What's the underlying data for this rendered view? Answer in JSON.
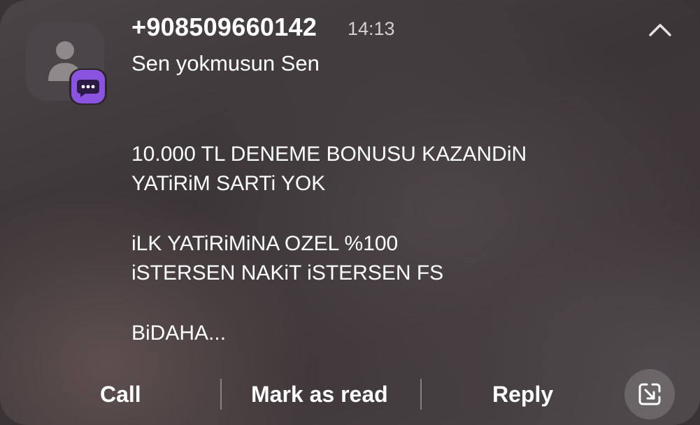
{
  "notification": {
    "sender": "+908509660142",
    "time": "14:13",
    "subject": "Sen yokmusun Sen",
    "body_lines": [
      "10.000 TL DENEME BONUSU KAZANDiN",
      "YATiRiM SARTi YOK",
      "",
      "iLK YATiRiMiNA OZEL %100",
      "iSTERSEN NAKiT iSTERSEN FS",
      "",
      "BiDAHA..."
    ]
  },
  "icons": {
    "avatar": "person-icon",
    "app_badge": "messages-app-icon",
    "collapse": "chevron-up-icon",
    "expand": "open-in-app-icon"
  },
  "actions": {
    "call": "Call",
    "mark_as_read": "Mark as read",
    "reply": "Reply"
  },
  "colors": {
    "badge_accent": "#8a54e0",
    "text": "#ffffff"
  }
}
